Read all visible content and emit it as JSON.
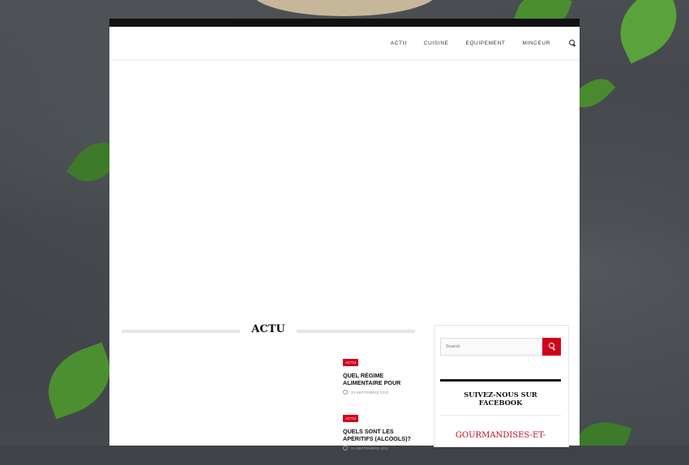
{
  "nav": {
    "items": [
      "ACTU",
      "CUISINE",
      "EQUIPEMENT",
      "MINCEUR"
    ],
    "search_icon": "search-icon"
  },
  "section": {
    "title": "ACTU"
  },
  "posts": [
    {
      "category": "ACTU",
      "title_line1": "QUEL RÉGIME",
      "title_line2": "ALIMENTAIRE POUR",
      "date": "24 SEPTEMBRE 2022"
    },
    {
      "category": "ACTU",
      "title_line1": "QUELS SONT LES",
      "title_line2": "APÉRITIFS (ALCOOLS)?",
      "date": "24 SEPTEMBRE 2022"
    }
  ],
  "sidebar": {
    "search_placeholder": "Search",
    "widget_title_line1": "SUIVEZ-NOUS SUR",
    "widget_title_line2": "FACEBOOK",
    "facebook_page": "GOURMANDISES-ET-"
  },
  "colors": {
    "accent": "#d0021b",
    "topbar": "#111111"
  }
}
